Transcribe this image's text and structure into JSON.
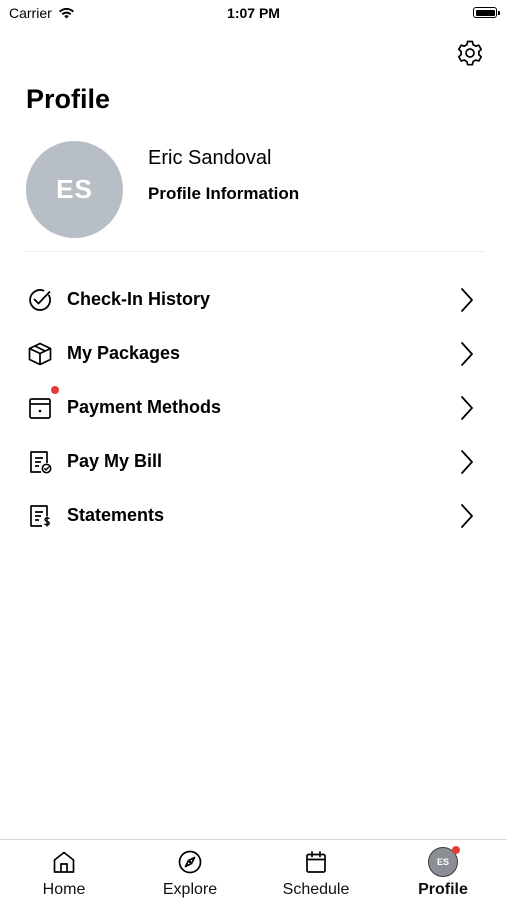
{
  "status_bar": {
    "carrier": "Carrier",
    "time": "1:07 PM"
  },
  "header": {
    "title": "Profile",
    "settings_icon": "gear-icon"
  },
  "profile": {
    "initials": "ES",
    "name": "Eric Sandoval",
    "info_link": "Profile Information",
    "avatar_color": "#b8bec6"
  },
  "menu": {
    "items": [
      {
        "label": "Check-In History",
        "icon": "check-circle-icon"
      },
      {
        "label": "My Packages",
        "icon": "package-icon"
      },
      {
        "label": "Payment Methods",
        "icon": "wallet-icon",
        "badge": true
      },
      {
        "label": "Pay My Bill",
        "icon": "bill-icon"
      },
      {
        "label": "Statements",
        "icon": "statement-icon"
      }
    ]
  },
  "tabbar": {
    "tabs": [
      {
        "label": "Home",
        "icon": "home-icon"
      },
      {
        "label": "Explore",
        "icon": "compass-icon"
      },
      {
        "label": "Schedule",
        "icon": "calendar-icon"
      },
      {
        "label": "Profile",
        "icon": "avatar",
        "initials": "ES",
        "active": true,
        "badge": true
      }
    ]
  },
  "colors": {
    "badge": "#e43d36",
    "divider": "#eeeeee"
  }
}
